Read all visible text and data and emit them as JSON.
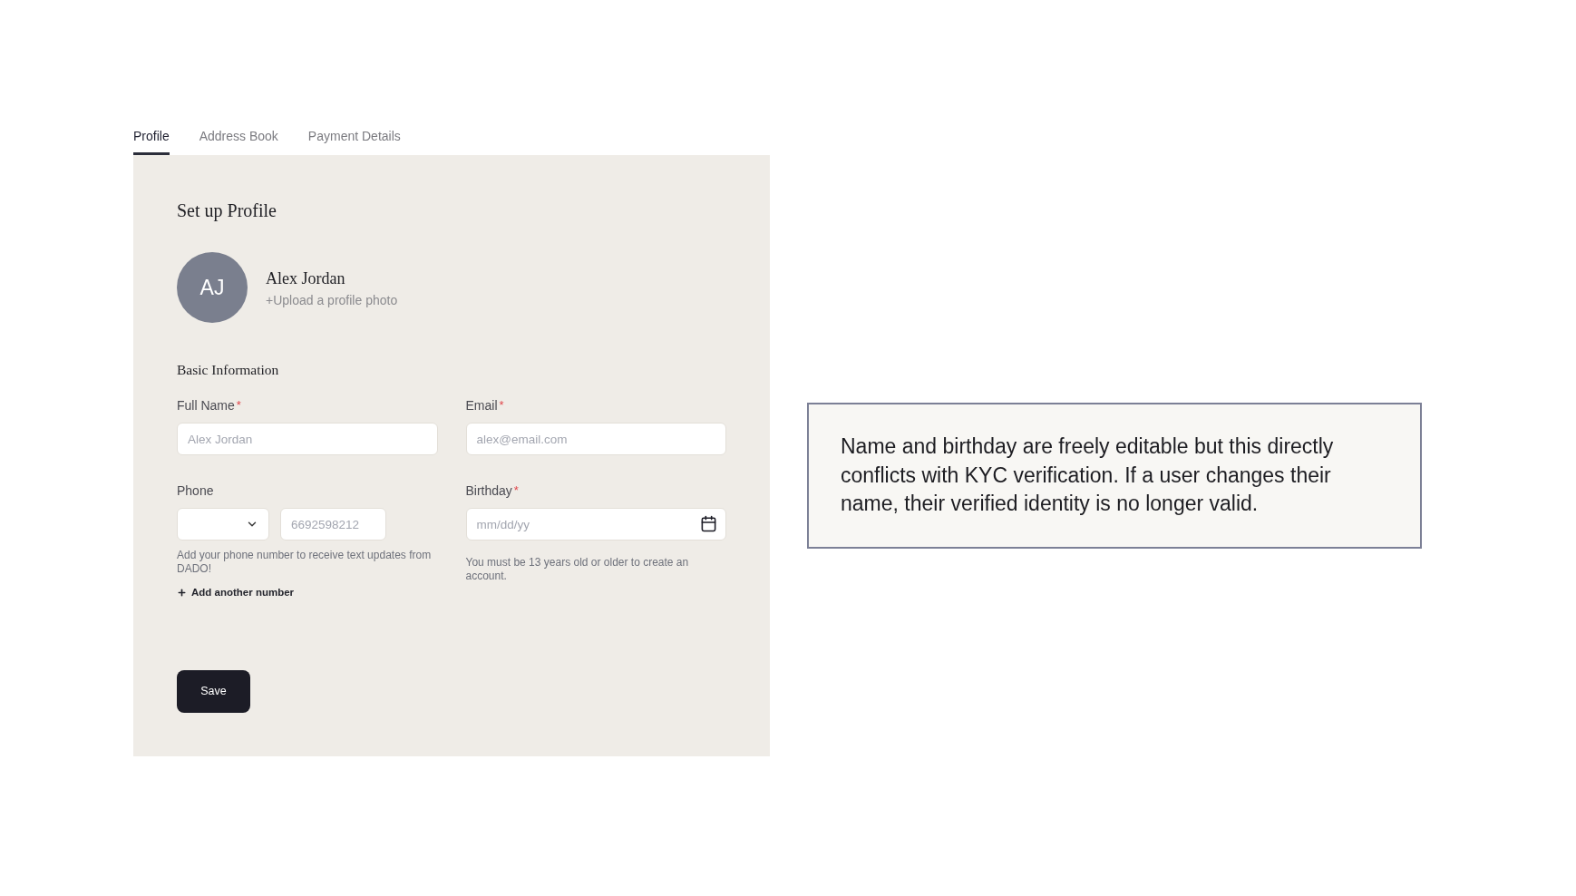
{
  "tabs": [
    {
      "label": "Profile",
      "selected": true
    },
    {
      "label": "Address Book",
      "selected": false
    },
    {
      "label": "Payment Details",
      "selected": false
    }
  ],
  "profile_panel": {
    "title": "Set up Profile",
    "avatar_initials": "AJ",
    "name": "Alex Jordan",
    "upload_link": "+Upload a profile photo"
  },
  "basic_information": {
    "heading": "Basic Information",
    "fields": [
      {
        "kind": "text",
        "label": "Full Name",
        "required_mark": "*",
        "placeholder": "Alex Jordan"
      },
      {
        "kind": "text",
        "label": "Email",
        "required_mark": "*",
        "placeholder": "alex@email.com"
      },
      {
        "kind": "phone",
        "label": "Phone",
        "placeholder": "6692598212",
        "help": "Add your phone number to receive text updates from DADO!",
        "add_link": "Add another number"
      },
      {
        "kind": "date",
        "label": "Birthday",
        "required_mark": "*",
        "placeholder": "mm/dd/yy",
        "help": "You must be 13 years old or older to create an account."
      }
    ]
  },
  "save_button": "Save",
  "note": {
    "text": "Name and birthday are freely editable but this directly conflicts with KYC verification. If a user changes their name, their verified identity is no longer valid."
  }
}
